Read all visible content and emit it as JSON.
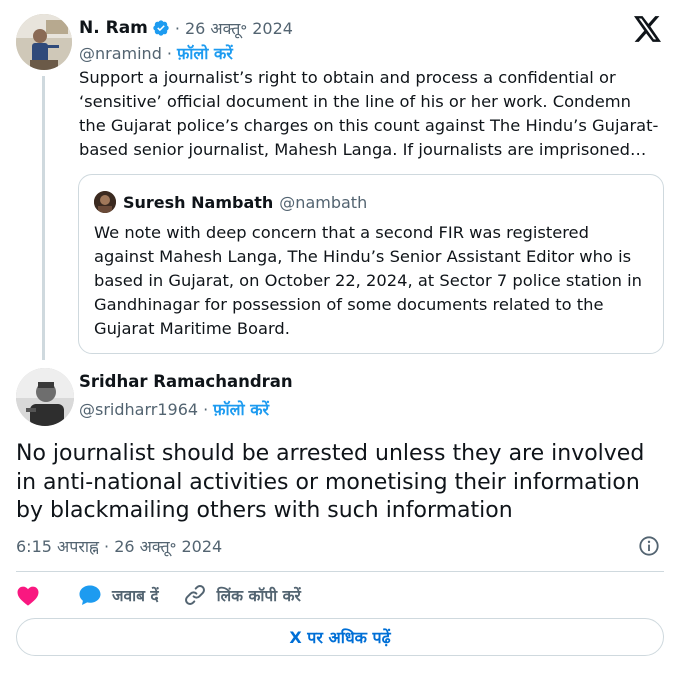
{
  "parent_tweet": {
    "author_name": "N. Ram",
    "date": "26 अक्तू॰ 2024",
    "handle": "@nramind",
    "follow_label": "फ़ॉलो करें",
    "text": "Support a journalist’s right to obtain and process a confidential or ‘sensitive’ official document in the line of his or her work. Condemn the Gujarat police’s charges on this count against The Hindu’s Gujarat-based senior  journalist, Mahesh Langa. If journalists are imprisoned…",
    "quote": {
      "author_name": "Suresh Nambath",
      "handle": "@nambath",
      "text": "We note with deep concern that a second FIR was registered against Mahesh Langa, The Hindu’s Senior Assistant Editor who is based in Gujarat, on October 22, 2024, at Sector 7 police station in Gandhinagar for possession of some documents related to the Gujarat Maritime Board."
    }
  },
  "main_tweet": {
    "author_name": "Sridhar Ramachandran",
    "handle": "@sridharr1964",
    "follow_label": "फ़ॉलो करें",
    "text": "No journalist should be arrested unless they are involved in anti-national activities or monetising their information by blackmailing others with such information",
    "timestamp": "6:15 अपराह्न · 26 अक्तू॰ 2024"
  },
  "actions": {
    "reply_label": "जवाब दें",
    "copy_link_label": "लिंक कॉपी करें",
    "read_more_label": "X पर अधिक पढ़ें"
  },
  "icons": {
    "like": "heart-icon",
    "reply": "speech-bubble-icon",
    "copy_link": "link-icon",
    "info": "info-icon",
    "platform": "x-logo-icon",
    "verified": "verified-badge-icon"
  },
  "colors": {
    "accent_blue": "#1d9bf0",
    "link_blue": "#006fd6",
    "like_pink": "#f91880",
    "text_primary": "#0f1419",
    "text_secondary": "#536471",
    "border": "#cfd9de"
  }
}
